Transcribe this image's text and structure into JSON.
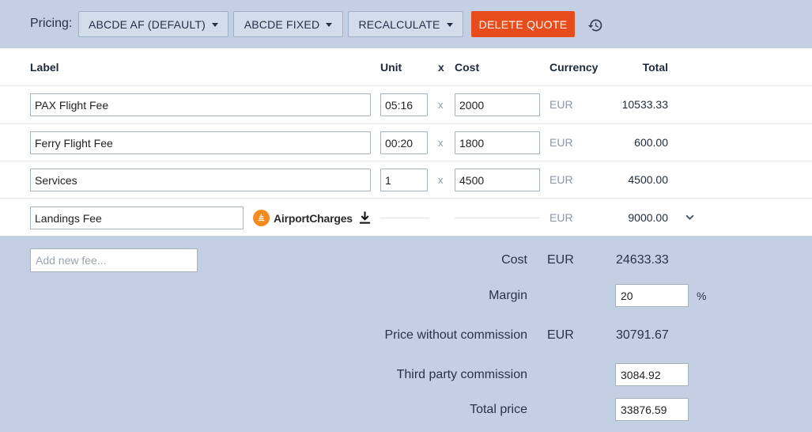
{
  "toolbar": {
    "pricing_label": "Pricing:",
    "pricing_profile": "ABCDE AF (DEFAULT)",
    "fixed_option": "ABCDE FIXED",
    "recalculate": "RECALCULATE",
    "delete_quote": "DELETE QUOTE"
  },
  "table": {
    "headers": {
      "label": "Label",
      "unit": "Unit",
      "x": "x",
      "cost": "Cost",
      "currency": "Currency",
      "total": "Total"
    },
    "rows": [
      {
        "label": "PAX Flight Fee",
        "unit": "05:16",
        "x": "x",
        "cost": "2000",
        "currency": "EUR",
        "total": "10533.33"
      },
      {
        "label": "Ferry Flight Fee",
        "unit": "00:20",
        "x": "x",
        "cost": "1800",
        "currency": "EUR",
        "total": "600.00"
      },
      {
        "label": "Services",
        "unit": "1",
        "x": "x",
        "cost": "4500",
        "currency": "EUR",
        "total": "4500.00"
      },
      {
        "label": "Landings Fee",
        "provider": "AirportCharges",
        "currency": "EUR",
        "total": "9000.00"
      }
    ]
  },
  "summary": {
    "add_fee_placeholder": "Add new fee...",
    "cost_label": "Cost",
    "cost_currency": "EUR",
    "cost_value": "24633.33",
    "margin_label": "Margin",
    "margin_value": "20",
    "margin_unit": "%",
    "pwc_label": "Price without commission",
    "pwc_currency": "EUR",
    "pwc_value": "30791.67",
    "commission_label": "Third party commission",
    "commission_value": "3084.92",
    "total_label": "Total price",
    "total_value": "33876.59"
  },
  "colors": {
    "accent_delete": "#e74c1c",
    "background": "#c3d0e3",
    "logo_orange": "#f58a1f"
  }
}
